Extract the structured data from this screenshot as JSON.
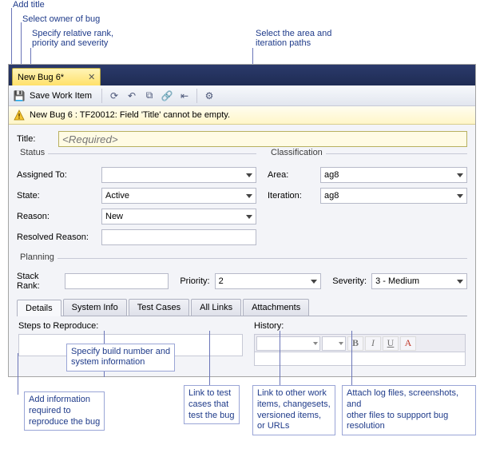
{
  "callouts": {
    "add_title": "Add title",
    "select_owner": "Select owner of bug",
    "rank_prio": "Specify relative rank,\npriority and severity",
    "area_iter": "Select the area and\niteration paths",
    "build_info": "Specify build number and\nsystem information",
    "reproduce": "Add information\nrequired to\nreproduce the bug",
    "test_cases": "Link to test\ncases that\ntest the bug",
    "other_links": "Link to other work\nitems, changesets,\nversioned items,\nor URLs",
    "attach": "Attach log files, screenshots, and\nother files to suppport bug\nresolution"
  },
  "tab": {
    "title": "New Bug 6*",
    "close": "✕"
  },
  "toolbar": {
    "save_label": "Save Work Item"
  },
  "warning": "New Bug 6 : TF20012: Field 'Title' cannot be empty.",
  "title_field": {
    "label": "Title:",
    "placeholder": "<Required>"
  },
  "status": {
    "group": "Status",
    "assigned_to": {
      "label": "Assigned To:",
      "value": ""
    },
    "state": {
      "label": "State:",
      "value": "Active"
    },
    "reason": {
      "label": "Reason:",
      "value": "New"
    },
    "resolved_reason": {
      "label": "Resolved Reason:",
      "value": ""
    }
  },
  "classification": {
    "group": "Classification",
    "area": {
      "label": "Area:",
      "value": "ag8"
    },
    "iteration": {
      "label": "Iteration:",
      "value": "ag8"
    }
  },
  "planning": {
    "group": "Planning",
    "stack_rank": {
      "label": "Stack Rank:",
      "value": ""
    },
    "priority": {
      "label": "Priority:",
      "value": "2"
    },
    "severity": {
      "label": "Severity:",
      "value": "3 - Medium"
    }
  },
  "tabs": {
    "details": "Details",
    "system_info": "System Info",
    "test_cases": "Test Cases",
    "all_links": "All Links",
    "attachments": "Attachments"
  },
  "details_tab": {
    "steps_label": "Steps to Reproduce:",
    "history_label": "History:"
  }
}
